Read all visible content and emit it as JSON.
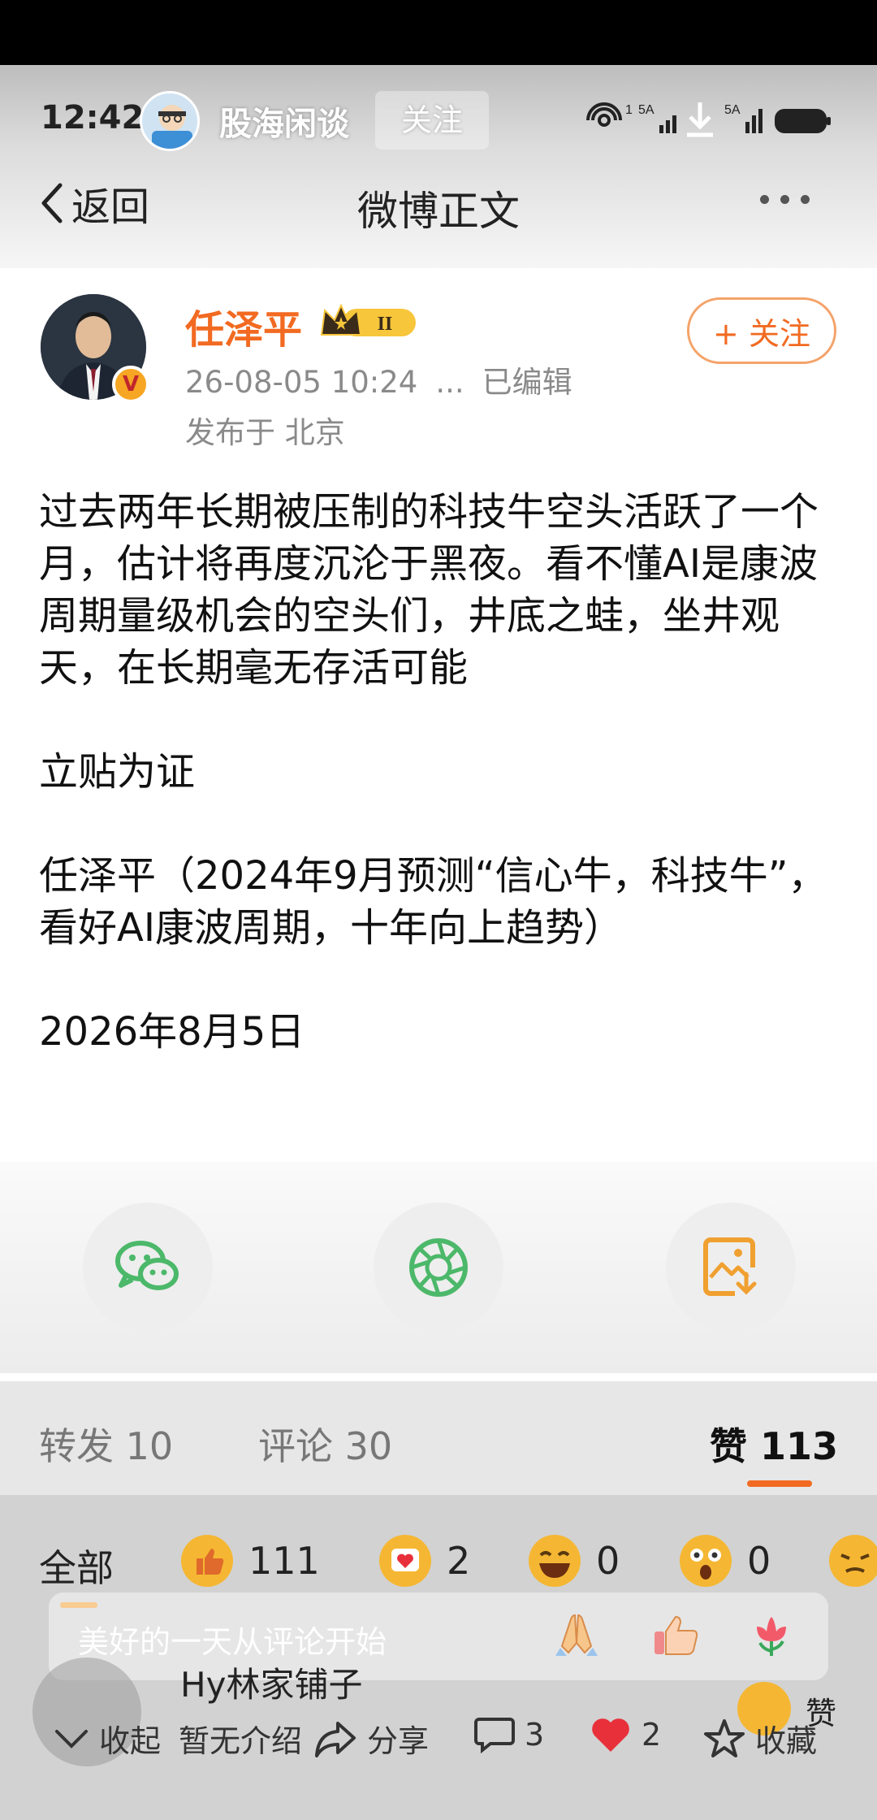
{
  "status_bar": {
    "time": "12:42"
  },
  "overlay_account": {
    "name": "股海闲谈",
    "follow_label": "关注"
  },
  "nav": {
    "back_label": "返回",
    "title": "微博正文"
  },
  "author": {
    "name": "任泽平",
    "level_badge": "II",
    "timestamp": "26-08-05 10:24",
    "ellipsis": "...",
    "edited": "已编辑",
    "location": "发布于 北京",
    "follow_label": "+ 关注"
  },
  "post": {
    "text": "过去两年长期被压制的科技牛空头活跃了一个月，估计将再度沉沦于黑夜。看不懂AI是康波周期量级机会的空头们，井底之蛙，坐井观天，在长期毫无存活可能\n\n立贴为证\n\n任泽平（2024年9月预测“信心牛，科技牛”，看好AI康波周期，十年向上趋势）\n\n2026年8月5日"
  },
  "share_icons": [
    "wechat-icon",
    "moments-icon",
    "save-image-icon"
  ],
  "stats": {
    "repost": "转发 10",
    "comment": "评论 30",
    "like_label": "赞",
    "like_count": "113"
  },
  "reactions": {
    "all_label": "全部",
    "items": [
      {
        "icon": "thumbs-up-icon",
        "count": "111"
      },
      {
        "icon": "heart-face-icon",
        "count": "2"
      },
      {
        "icon": "laugh-icon",
        "count": "0"
      },
      {
        "icon": "surprised-icon",
        "count": "0"
      }
    ]
  },
  "comment_overlay": {
    "placeholder": "美好的一天从评论开始",
    "emojis": [
      "pray-emoji",
      "thumbs-up-emoji",
      "flower-emoji"
    ]
  },
  "overlay_user": {
    "name": "Hy林家铺子",
    "like_label": "赞"
  },
  "bottom_bar": {
    "collapse": "收起",
    "intro": "暂无介绍",
    "share": "分享",
    "comments": "3",
    "likes": "2",
    "favorite": "收藏"
  },
  "colors": {
    "accent_orange": "#f26a21",
    "wechat_green": "#4cb86a",
    "like_red": "#e8303a"
  }
}
